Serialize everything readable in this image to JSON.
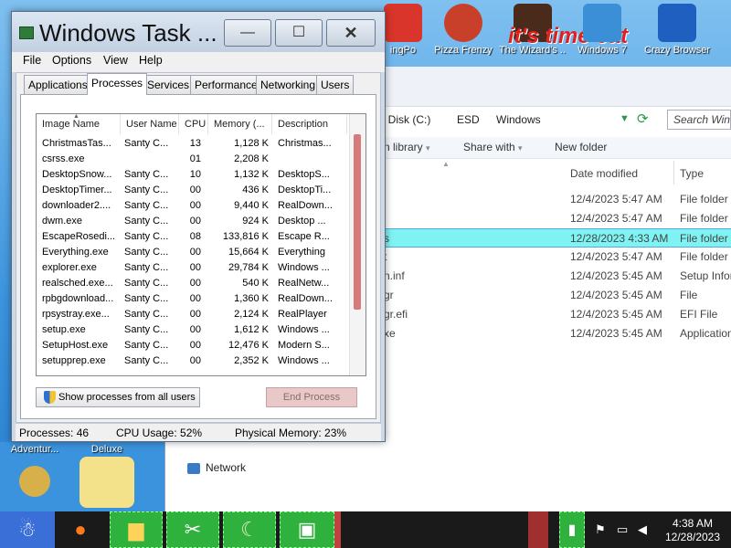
{
  "desktop": {
    "icons": [
      {
        "label": "ingPo",
        "color": "#d9352b"
      },
      {
        "label": "Pizza Frenzy",
        "color": "#c8402a"
      },
      {
        "label": "The Wizard's ...",
        "color": "#4a2a1a"
      },
      {
        "label": "Windows 7",
        "color": "#3a8fd6"
      },
      {
        "label": "Crazy Browser",
        "color": "#1f5fbf"
      },
      {
        "label": "Adventur...",
        "color": "#d8b04a"
      },
      {
        "label": "Deluxe",
        "color": "#c99a5a"
      }
    ],
    "banner_text": "it's time eat"
  },
  "explorer": {
    "breadcrumbs": [
      "al Disk (C:)",
      "ESD",
      "Windows"
    ],
    "search_placeholder": "Search Wind",
    "toolbar": [
      "n library",
      "Share with",
      "New folder"
    ],
    "columns": [
      "Date modified",
      "Type"
    ],
    "rows": [
      {
        "name": "",
        "date": "12/4/2023 5:47 AM",
        "type": "File folder",
        "selected": false
      },
      {
        "name": "",
        "date": "12/4/2023 5:47 AM",
        "type": "File folder",
        "selected": false
      },
      {
        "name": "s",
        "date": "12/28/2023 4:33 AM",
        "type": "File folder",
        "selected": true
      },
      {
        "name": "t",
        "date": "12/4/2023 5:47 AM",
        "type": "File folder",
        "selected": false
      },
      {
        "name": "n.inf",
        "date": "12/4/2023 5:45 AM",
        "type": "Setup Infor",
        "selected": false
      },
      {
        "name": "gr",
        "date": "12/4/2023 5:45 AM",
        "type": "File",
        "selected": false
      },
      {
        "name": "gr.efi",
        "date": "12/4/2023 5:45 AM",
        "type": "EFI File",
        "selected": false
      },
      {
        "name": "xe",
        "date": "12/4/2023 5:45 AM",
        "type": "Application",
        "selected": false
      }
    ],
    "network_label": "Network"
  },
  "taskmgr": {
    "title": "Windows Task ...",
    "window_buttons": {
      "minimize": "—",
      "maximize": "☐",
      "close": "✕"
    },
    "menu": [
      "File",
      "Options",
      "View",
      "Help"
    ],
    "tabs": [
      "Applications",
      "Processes",
      "Services",
      "Performance",
      "Networking",
      "Users"
    ],
    "active_tab": "Processes",
    "columns": [
      "Image Name",
      "User Name",
      "CPU",
      "Memory (...",
      "Description"
    ],
    "processes": [
      [
        "ChristmasTas...",
        "Santy C...",
        "13",
        "1,128 K",
        "Christmas..."
      ],
      [
        "csrss.exe",
        "",
        "01",
        "2,208 K",
        ""
      ],
      [
        "DesktopSnow...",
        "Santy C...",
        "10",
        "1,132 K",
        "DesktopS..."
      ],
      [
        "DesktopTimer...",
        "Santy C...",
        "00",
        "436 K",
        "DesktopTi..."
      ],
      [
        "downloader2....",
        "Santy C...",
        "00",
        "9,440 K",
        "RealDown..."
      ],
      [
        "dwm.exe",
        "Santy C...",
        "00",
        "924 K",
        "Desktop ..."
      ],
      [
        "EscapeRosedi...",
        "Santy C...",
        "08",
        "133,816 K",
        "Escape R..."
      ],
      [
        "Everything.exe",
        "Santy C...",
        "00",
        "15,664 K",
        "Everything"
      ],
      [
        "explorer.exe",
        "Santy C...",
        "00",
        "29,784 K",
        "Windows ..."
      ],
      [
        "realsched.exe...",
        "Santy C...",
        "00",
        "540 K",
        "RealNetw..."
      ],
      [
        "rpbgdownload...",
        "Santy C...",
        "00",
        "1,360 K",
        "RealDown..."
      ],
      [
        "rpsystray.exe...",
        "Santy C...",
        "00",
        "2,124 K",
        "RealPlayer"
      ],
      [
        "setup.exe",
        "Santy C...",
        "00",
        "1,612 K",
        "Windows ..."
      ],
      [
        "SetupHost.exe",
        "Santy C...",
        "00",
        "12,476 K",
        "Modern S..."
      ],
      [
        "setupprep.exe",
        "Santy C...",
        "00",
        "2,352 K",
        "Windows ..."
      ]
    ],
    "show_all_label": "Show processes from all users",
    "end_process_label": "End Process",
    "status": {
      "processes": "Processes: 46",
      "cpu": "CPU Usage: 52%",
      "memory": "Physical Memory: 23%"
    }
  },
  "taskbar": {
    "apps": [
      "santa-icon",
      "firefox-icon",
      "explorer-icon",
      "screenshot-icon",
      "moon-icon",
      "monitor-icon"
    ],
    "clock_time": "4:38 AM",
    "clock_date": "12/28/2023"
  }
}
